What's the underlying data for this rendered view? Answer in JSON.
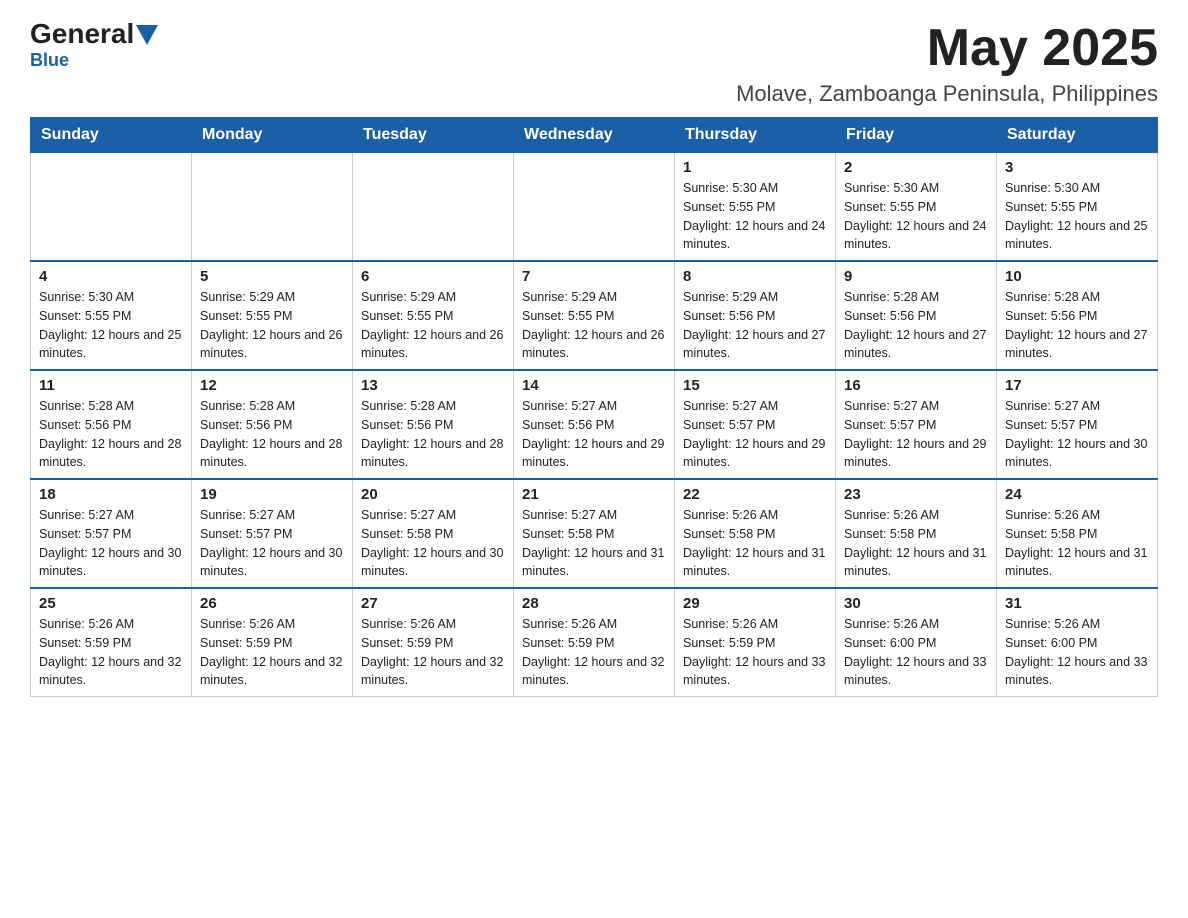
{
  "logo": {
    "text_general": "General",
    "text_blue": "Blue"
  },
  "title": {
    "month_year": "May 2025",
    "location": "Molave, Zamboanga Peninsula, Philippines"
  },
  "days_of_week": [
    "Sunday",
    "Monday",
    "Tuesday",
    "Wednesday",
    "Thursday",
    "Friday",
    "Saturday"
  ],
  "weeks": [
    [
      {
        "day": "",
        "sunrise": "",
        "sunset": "",
        "daylight": ""
      },
      {
        "day": "",
        "sunrise": "",
        "sunset": "",
        "daylight": ""
      },
      {
        "day": "",
        "sunrise": "",
        "sunset": "",
        "daylight": ""
      },
      {
        "day": "",
        "sunrise": "",
        "sunset": "",
        "daylight": ""
      },
      {
        "day": "1",
        "sunrise": "Sunrise: 5:30 AM",
        "sunset": "Sunset: 5:55 PM",
        "daylight": "Daylight: 12 hours and 24 minutes."
      },
      {
        "day": "2",
        "sunrise": "Sunrise: 5:30 AM",
        "sunset": "Sunset: 5:55 PM",
        "daylight": "Daylight: 12 hours and 24 minutes."
      },
      {
        "day": "3",
        "sunrise": "Sunrise: 5:30 AM",
        "sunset": "Sunset: 5:55 PM",
        "daylight": "Daylight: 12 hours and 25 minutes."
      }
    ],
    [
      {
        "day": "4",
        "sunrise": "Sunrise: 5:30 AM",
        "sunset": "Sunset: 5:55 PM",
        "daylight": "Daylight: 12 hours and 25 minutes."
      },
      {
        "day": "5",
        "sunrise": "Sunrise: 5:29 AM",
        "sunset": "Sunset: 5:55 PM",
        "daylight": "Daylight: 12 hours and 26 minutes."
      },
      {
        "day": "6",
        "sunrise": "Sunrise: 5:29 AM",
        "sunset": "Sunset: 5:55 PM",
        "daylight": "Daylight: 12 hours and 26 minutes."
      },
      {
        "day": "7",
        "sunrise": "Sunrise: 5:29 AM",
        "sunset": "Sunset: 5:55 PM",
        "daylight": "Daylight: 12 hours and 26 minutes."
      },
      {
        "day": "8",
        "sunrise": "Sunrise: 5:29 AM",
        "sunset": "Sunset: 5:56 PM",
        "daylight": "Daylight: 12 hours and 27 minutes."
      },
      {
        "day": "9",
        "sunrise": "Sunrise: 5:28 AM",
        "sunset": "Sunset: 5:56 PM",
        "daylight": "Daylight: 12 hours and 27 minutes."
      },
      {
        "day": "10",
        "sunrise": "Sunrise: 5:28 AM",
        "sunset": "Sunset: 5:56 PM",
        "daylight": "Daylight: 12 hours and 27 minutes."
      }
    ],
    [
      {
        "day": "11",
        "sunrise": "Sunrise: 5:28 AM",
        "sunset": "Sunset: 5:56 PM",
        "daylight": "Daylight: 12 hours and 28 minutes."
      },
      {
        "day": "12",
        "sunrise": "Sunrise: 5:28 AM",
        "sunset": "Sunset: 5:56 PM",
        "daylight": "Daylight: 12 hours and 28 minutes."
      },
      {
        "day": "13",
        "sunrise": "Sunrise: 5:28 AM",
        "sunset": "Sunset: 5:56 PM",
        "daylight": "Daylight: 12 hours and 28 minutes."
      },
      {
        "day": "14",
        "sunrise": "Sunrise: 5:27 AM",
        "sunset": "Sunset: 5:56 PM",
        "daylight": "Daylight: 12 hours and 29 minutes."
      },
      {
        "day": "15",
        "sunrise": "Sunrise: 5:27 AM",
        "sunset": "Sunset: 5:57 PM",
        "daylight": "Daylight: 12 hours and 29 minutes."
      },
      {
        "day": "16",
        "sunrise": "Sunrise: 5:27 AM",
        "sunset": "Sunset: 5:57 PM",
        "daylight": "Daylight: 12 hours and 29 minutes."
      },
      {
        "day": "17",
        "sunrise": "Sunrise: 5:27 AM",
        "sunset": "Sunset: 5:57 PM",
        "daylight": "Daylight: 12 hours and 30 minutes."
      }
    ],
    [
      {
        "day": "18",
        "sunrise": "Sunrise: 5:27 AM",
        "sunset": "Sunset: 5:57 PM",
        "daylight": "Daylight: 12 hours and 30 minutes."
      },
      {
        "day": "19",
        "sunrise": "Sunrise: 5:27 AM",
        "sunset": "Sunset: 5:57 PM",
        "daylight": "Daylight: 12 hours and 30 minutes."
      },
      {
        "day": "20",
        "sunrise": "Sunrise: 5:27 AM",
        "sunset": "Sunset: 5:58 PM",
        "daylight": "Daylight: 12 hours and 30 minutes."
      },
      {
        "day": "21",
        "sunrise": "Sunrise: 5:27 AM",
        "sunset": "Sunset: 5:58 PM",
        "daylight": "Daylight: 12 hours and 31 minutes."
      },
      {
        "day": "22",
        "sunrise": "Sunrise: 5:26 AM",
        "sunset": "Sunset: 5:58 PM",
        "daylight": "Daylight: 12 hours and 31 minutes."
      },
      {
        "day": "23",
        "sunrise": "Sunrise: 5:26 AM",
        "sunset": "Sunset: 5:58 PM",
        "daylight": "Daylight: 12 hours and 31 minutes."
      },
      {
        "day": "24",
        "sunrise": "Sunrise: 5:26 AM",
        "sunset": "Sunset: 5:58 PM",
        "daylight": "Daylight: 12 hours and 31 minutes."
      }
    ],
    [
      {
        "day": "25",
        "sunrise": "Sunrise: 5:26 AM",
        "sunset": "Sunset: 5:59 PM",
        "daylight": "Daylight: 12 hours and 32 minutes."
      },
      {
        "day": "26",
        "sunrise": "Sunrise: 5:26 AM",
        "sunset": "Sunset: 5:59 PM",
        "daylight": "Daylight: 12 hours and 32 minutes."
      },
      {
        "day": "27",
        "sunrise": "Sunrise: 5:26 AM",
        "sunset": "Sunset: 5:59 PM",
        "daylight": "Daylight: 12 hours and 32 minutes."
      },
      {
        "day": "28",
        "sunrise": "Sunrise: 5:26 AM",
        "sunset": "Sunset: 5:59 PM",
        "daylight": "Daylight: 12 hours and 32 minutes."
      },
      {
        "day": "29",
        "sunrise": "Sunrise: 5:26 AM",
        "sunset": "Sunset: 5:59 PM",
        "daylight": "Daylight: 12 hours and 33 minutes."
      },
      {
        "day": "30",
        "sunrise": "Sunrise: 5:26 AM",
        "sunset": "Sunset: 6:00 PM",
        "daylight": "Daylight: 12 hours and 33 minutes."
      },
      {
        "day": "31",
        "sunrise": "Sunrise: 5:26 AM",
        "sunset": "Sunset: 6:00 PM",
        "daylight": "Daylight: 12 hours and 33 minutes."
      }
    ]
  ]
}
